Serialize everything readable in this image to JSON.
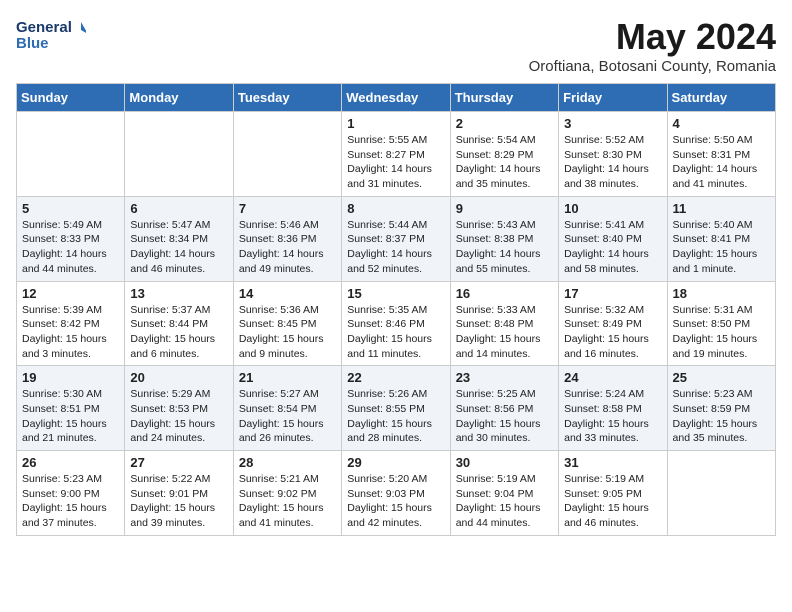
{
  "header": {
    "logo_line1": "General",
    "logo_line2": "Blue",
    "month_title": "May 2024",
    "location": "Oroftiana, Botosani County, Romania"
  },
  "weekdays": [
    "Sunday",
    "Monday",
    "Tuesday",
    "Wednesday",
    "Thursday",
    "Friday",
    "Saturday"
  ],
  "weeks": [
    [
      {
        "day": "",
        "info": ""
      },
      {
        "day": "",
        "info": ""
      },
      {
        "day": "",
        "info": ""
      },
      {
        "day": "1",
        "info": "Sunrise: 5:55 AM\nSunset: 8:27 PM\nDaylight: 14 hours\nand 31 minutes."
      },
      {
        "day": "2",
        "info": "Sunrise: 5:54 AM\nSunset: 8:29 PM\nDaylight: 14 hours\nand 35 minutes."
      },
      {
        "day": "3",
        "info": "Sunrise: 5:52 AM\nSunset: 8:30 PM\nDaylight: 14 hours\nand 38 minutes."
      },
      {
        "day": "4",
        "info": "Sunrise: 5:50 AM\nSunset: 8:31 PM\nDaylight: 14 hours\nand 41 minutes."
      }
    ],
    [
      {
        "day": "5",
        "info": "Sunrise: 5:49 AM\nSunset: 8:33 PM\nDaylight: 14 hours\nand 44 minutes."
      },
      {
        "day": "6",
        "info": "Sunrise: 5:47 AM\nSunset: 8:34 PM\nDaylight: 14 hours\nand 46 minutes."
      },
      {
        "day": "7",
        "info": "Sunrise: 5:46 AM\nSunset: 8:36 PM\nDaylight: 14 hours\nand 49 minutes."
      },
      {
        "day": "8",
        "info": "Sunrise: 5:44 AM\nSunset: 8:37 PM\nDaylight: 14 hours\nand 52 minutes."
      },
      {
        "day": "9",
        "info": "Sunrise: 5:43 AM\nSunset: 8:38 PM\nDaylight: 14 hours\nand 55 minutes."
      },
      {
        "day": "10",
        "info": "Sunrise: 5:41 AM\nSunset: 8:40 PM\nDaylight: 14 hours\nand 58 minutes."
      },
      {
        "day": "11",
        "info": "Sunrise: 5:40 AM\nSunset: 8:41 PM\nDaylight: 15 hours\nand 1 minute."
      }
    ],
    [
      {
        "day": "12",
        "info": "Sunrise: 5:39 AM\nSunset: 8:42 PM\nDaylight: 15 hours\nand 3 minutes."
      },
      {
        "day": "13",
        "info": "Sunrise: 5:37 AM\nSunset: 8:44 PM\nDaylight: 15 hours\nand 6 minutes."
      },
      {
        "day": "14",
        "info": "Sunrise: 5:36 AM\nSunset: 8:45 PM\nDaylight: 15 hours\nand 9 minutes."
      },
      {
        "day": "15",
        "info": "Sunrise: 5:35 AM\nSunset: 8:46 PM\nDaylight: 15 hours\nand 11 minutes."
      },
      {
        "day": "16",
        "info": "Sunrise: 5:33 AM\nSunset: 8:48 PM\nDaylight: 15 hours\nand 14 minutes."
      },
      {
        "day": "17",
        "info": "Sunrise: 5:32 AM\nSunset: 8:49 PM\nDaylight: 15 hours\nand 16 minutes."
      },
      {
        "day": "18",
        "info": "Sunrise: 5:31 AM\nSunset: 8:50 PM\nDaylight: 15 hours\nand 19 minutes."
      }
    ],
    [
      {
        "day": "19",
        "info": "Sunrise: 5:30 AM\nSunset: 8:51 PM\nDaylight: 15 hours\nand 21 minutes."
      },
      {
        "day": "20",
        "info": "Sunrise: 5:29 AM\nSunset: 8:53 PM\nDaylight: 15 hours\nand 24 minutes."
      },
      {
        "day": "21",
        "info": "Sunrise: 5:27 AM\nSunset: 8:54 PM\nDaylight: 15 hours\nand 26 minutes."
      },
      {
        "day": "22",
        "info": "Sunrise: 5:26 AM\nSunset: 8:55 PM\nDaylight: 15 hours\nand 28 minutes."
      },
      {
        "day": "23",
        "info": "Sunrise: 5:25 AM\nSunset: 8:56 PM\nDaylight: 15 hours\nand 30 minutes."
      },
      {
        "day": "24",
        "info": "Sunrise: 5:24 AM\nSunset: 8:58 PM\nDaylight: 15 hours\nand 33 minutes."
      },
      {
        "day": "25",
        "info": "Sunrise: 5:23 AM\nSunset: 8:59 PM\nDaylight: 15 hours\nand 35 minutes."
      }
    ],
    [
      {
        "day": "26",
        "info": "Sunrise: 5:23 AM\nSunset: 9:00 PM\nDaylight: 15 hours\nand 37 minutes."
      },
      {
        "day": "27",
        "info": "Sunrise: 5:22 AM\nSunset: 9:01 PM\nDaylight: 15 hours\nand 39 minutes."
      },
      {
        "day": "28",
        "info": "Sunrise: 5:21 AM\nSunset: 9:02 PM\nDaylight: 15 hours\nand 41 minutes."
      },
      {
        "day": "29",
        "info": "Sunrise: 5:20 AM\nSunset: 9:03 PM\nDaylight: 15 hours\nand 42 minutes."
      },
      {
        "day": "30",
        "info": "Sunrise: 5:19 AM\nSunset: 9:04 PM\nDaylight: 15 hours\nand 44 minutes."
      },
      {
        "day": "31",
        "info": "Sunrise: 5:19 AM\nSunset: 9:05 PM\nDaylight: 15 hours\nand 46 minutes."
      },
      {
        "day": "",
        "info": ""
      }
    ]
  ]
}
